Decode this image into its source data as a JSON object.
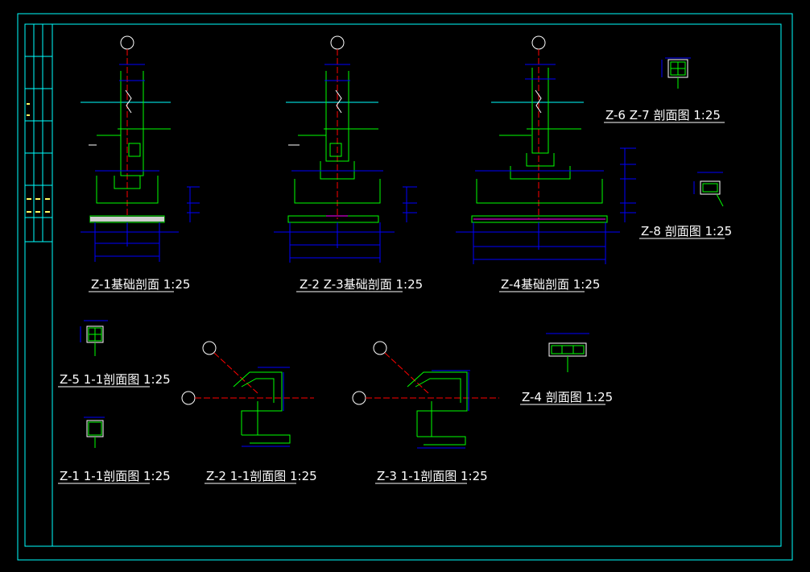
{
  "colors": {
    "background": "#000000",
    "border": "#00ffff",
    "section_outline": "#00ff00",
    "dimension": "#0000ff",
    "axis_line": "#ff0000",
    "hatch": "#ff00ff",
    "grade_line": "#00ffff",
    "title_text": "#ffffff",
    "axis_bubble": "#ffffff"
  },
  "titles": {
    "z1_foundation": "Z-1基础剖面 1:25",
    "z2_z3_foundation": "Z-2 Z-3基础剖面 1:25",
    "z4_foundation": "Z-4基础剖面 1:25",
    "z6_z7_section": "Z-6 Z-7 剖面图 1:25",
    "z8_section": "Z-8 剖面图 1:25",
    "z5_11_section": "Z-5 1-1剖面图 1:25",
    "z1_11_section": "Z-1 1-1剖面图 1:25",
    "z2_11_section": "Z-2 1-1剖面图 1:25",
    "z3_11_section": "Z-3 1-1剖面图 1:25",
    "z4_section": "Z-4 剖面图 1:25"
  }
}
